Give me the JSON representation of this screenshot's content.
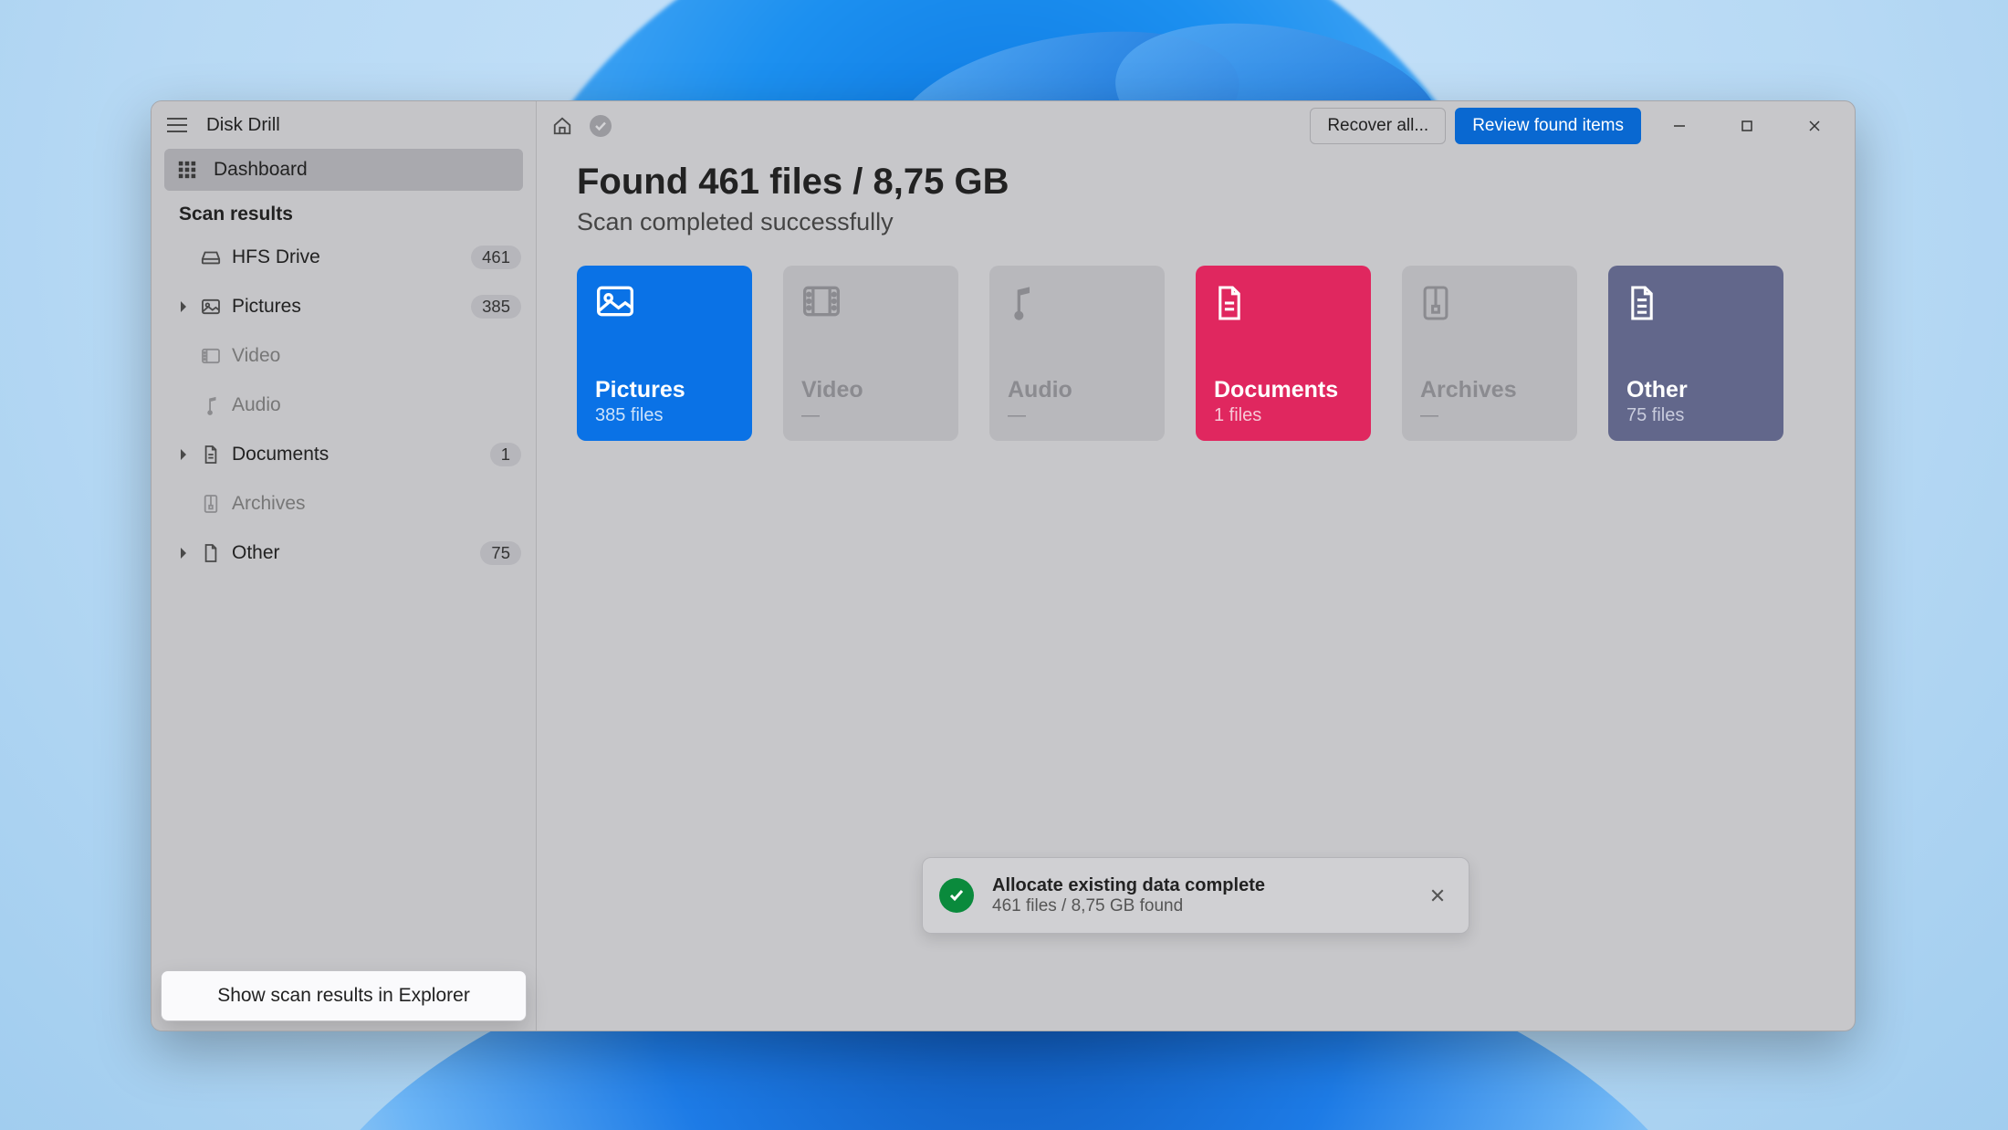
{
  "app": {
    "title": "Disk Drill"
  },
  "sidebar": {
    "dash_label": "Dashboard",
    "scan_heading": "Scan results",
    "items": [
      {
        "label": "HFS Drive",
        "badge": "461",
        "expandable": false,
        "muted": false
      },
      {
        "label": "Pictures",
        "badge": "385",
        "expandable": true,
        "muted": false
      },
      {
        "label": "Video",
        "badge": "",
        "expandable": false,
        "muted": true
      },
      {
        "label": "Audio",
        "badge": "",
        "expandable": false,
        "muted": true
      },
      {
        "label": "Documents",
        "badge": "1",
        "expandable": true,
        "muted": false
      },
      {
        "label": "Archives",
        "badge": "",
        "expandable": false,
        "muted": true
      },
      {
        "label": "Other",
        "badge": "75",
        "expandable": true,
        "muted": false
      }
    ],
    "footer_button": "Show scan results in Explorer"
  },
  "toolbar": {
    "recover_label": "Recover all...",
    "review_label": "Review found items"
  },
  "main": {
    "title": "Found 461 files / 8,75 GB",
    "subtitle": "Scan completed successfully",
    "cards": [
      {
        "title": "Pictures",
        "sub": "385 files",
        "variant": "blue"
      },
      {
        "title": "Video",
        "sub": "—",
        "variant": "grey"
      },
      {
        "title": "Audio",
        "sub": "—",
        "variant": "grey"
      },
      {
        "title": "Documents",
        "sub": "1 files",
        "variant": "pink"
      },
      {
        "title": "Archives",
        "sub": "—",
        "variant": "grey"
      },
      {
        "title": "Other",
        "sub": "75 files",
        "variant": "slate"
      }
    ]
  },
  "toast": {
    "title": "Allocate existing data complete",
    "sub": "461 files / 8,75 GB found"
  },
  "colors": {
    "accent": "#0968d1",
    "pink": "#e0275f",
    "slate": "#62678b"
  }
}
